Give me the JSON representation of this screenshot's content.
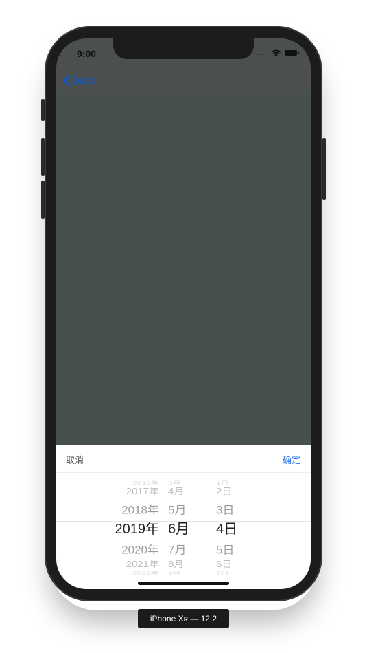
{
  "status_bar": {
    "time": "9:00",
    "signal": "....",
    "wifi_icon": "wifi-icon",
    "battery_icon": "battery-icon"
  },
  "nav": {
    "back_label": "Back",
    "back_icon": "chevron-left-icon",
    "accent": "#0a58c8"
  },
  "sheet": {
    "cancel_label": "取消",
    "confirm_label": "确定",
    "confirm_color": "#3478f6"
  },
  "picker": {
    "years": [
      "2016年",
      "2017年",
      "2018年",
      "2019年",
      "2020年",
      "2021年",
      "2022年"
    ],
    "months": [
      "3月",
      "4月",
      "5月",
      "6月",
      "7月",
      "8月",
      "9月"
    ],
    "days": [
      "1日",
      "2日",
      "3日",
      "4日",
      "5日",
      "6日",
      "7日"
    ],
    "selected": {
      "year": "2019年",
      "month": "6月",
      "day": "4日"
    }
  },
  "device_label": "iPhone Xʀ — 12.2"
}
